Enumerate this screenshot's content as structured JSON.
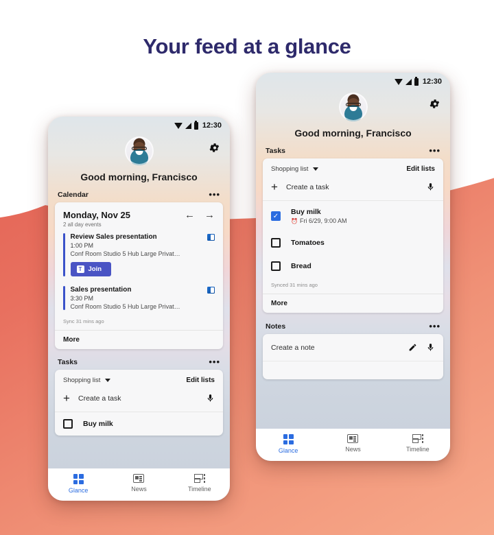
{
  "headline": "Your feed at a glance",
  "theme": {
    "coral_dark": "#E05A4E",
    "coral_light": "#F7A98A",
    "headline_color": "#2E2A6B",
    "accent_blue": "#2B6CE0",
    "teams_purple": "#4A54C4"
  },
  "phone_left": {
    "status_bar": {
      "time": "12:30",
      "icons": [
        "wifi-icon",
        "signal-icon",
        "battery-icon"
      ]
    },
    "settings_icon": "gear-icon",
    "greeting": "Good morning, Francisco",
    "calendar": {
      "section_label": "Calendar",
      "overflow": "•••",
      "date": "Monday, Nov 25",
      "subtitle": "2 all day events",
      "prev_icon": "←",
      "next_icon": "→",
      "events": [
        {
          "title": "Review Sales presentation",
          "time": "1:00 PM",
          "location": "Conf Room Studio 5 Hub Large Privat…",
          "source_icon": "outlook-icon",
          "join_label": "Join",
          "join_icon": "teams-icon"
        },
        {
          "title": "Sales presentation",
          "time": "3:30 PM",
          "location": "Conf Room Studio 5 Hub Large Privat…",
          "source_icon": "outlook-icon"
        }
      ],
      "sync": "Sync 31 mins ago",
      "more": "More"
    },
    "tasks": {
      "section_label": "Tasks",
      "overflow": "•••",
      "list_name": "Shopping list",
      "edit_lists": "Edit lists",
      "create_task": "Create a task",
      "mic_icon": "microphone-icon",
      "first_task": "Buy milk"
    },
    "nav": [
      {
        "label": "Glance",
        "icon": "glance-icon",
        "active": true
      },
      {
        "label": "News",
        "icon": "news-icon",
        "active": false
      },
      {
        "label": "Timeline",
        "icon": "timeline-icon",
        "active": false
      }
    ]
  },
  "phone_right": {
    "status_bar": {
      "time": "12:30",
      "icons": [
        "wifi-icon",
        "signal-icon",
        "battery-icon"
      ]
    },
    "settings_icon": "gear-icon",
    "greeting": "Good morning, Francisco",
    "tasks": {
      "section_label": "Tasks",
      "overflow": "•••",
      "list_name": "Shopping list",
      "edit_lists": "Edit lists",
      "create_task": "Create a task",
      "mic_icon": "microphone-icon",
      "items": [
        {
          "title": "Buy milk",
          "due": "Fri 6/29, 9:00 AM",
          "checked": true,
          "due_icon": "alarm-icon"
        },
        {
          "title": "Tomatoes",
          "due": "",
          "checked": false
        },
        {
          "title": "Bread",
          "due": "",
          "checked": false
        }
      ],
      "sync": "Synced 31 mins ago",
      "more": "More"
    },
    "notes": {
      "section_label": "Notes",
      "overflow": "•••",
      "create_note": "Create a note",
      "pencil_icon": "pencil-icon",
      "mic_icon": "microphone-icon"
    },
    "nav": [
      {
        "label": "Glance",
        "icon": "glance-icon",
        "active": true
      },
      {
        "label": "News",
        "icon": "news-icon",
        "active": false
      },
      {
        "label": "Timeline",
        "icon": "timeline-icon",
        "active": false
      }
    ]
  }
}
